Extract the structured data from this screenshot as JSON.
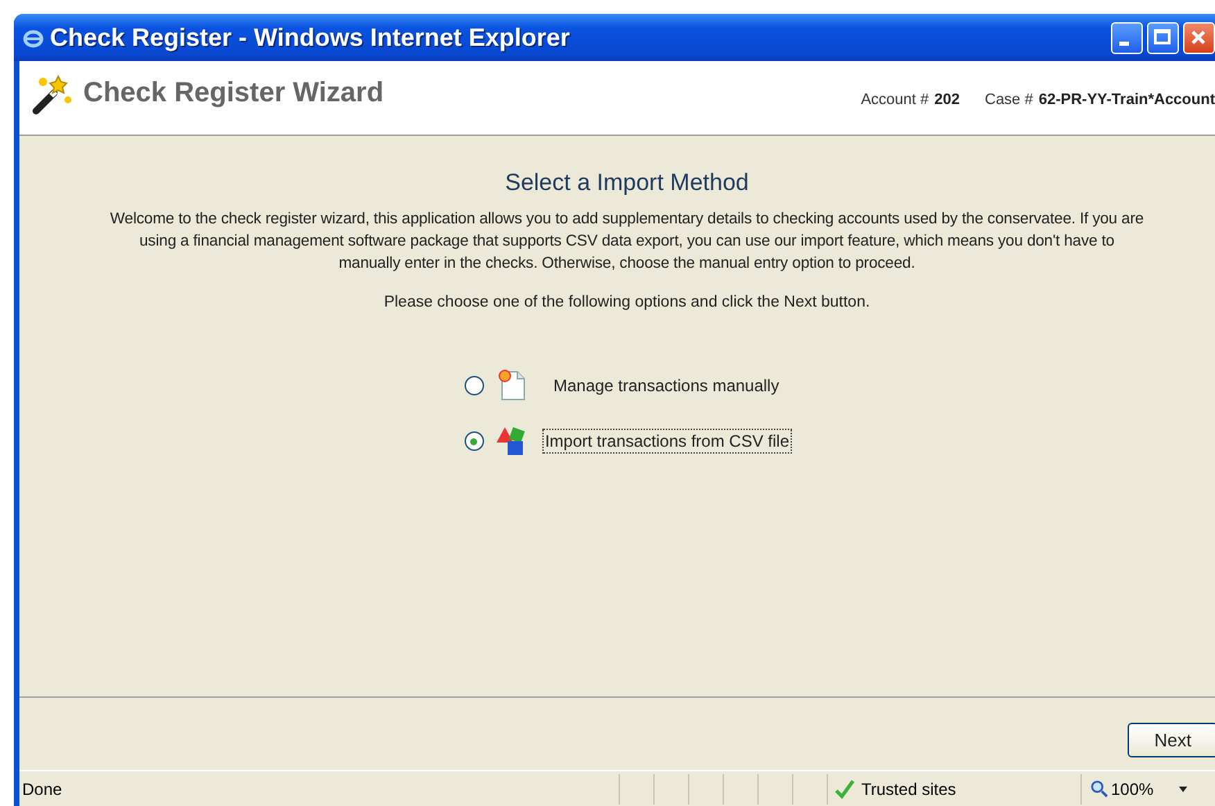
{
  "window": {
    "title": "Check Register - Windows Internet Explorer"
  },
  "header": {
    "title": "Check Register Wizard",
    "account_label": "Account #",
    "account": "202",
    "case_label": "Case #",
    "case": "62-PR-YY-Train*Account"
  },
  "content": {
    "heading": "Select a Import Method",
    "intro": "Welcome to the check register wizard, this application allows you to add supplementary details to checking accounts used by the conservatee. If you are using a financial management software package that supports CSV data export, you can use our import feature, which means you don't have to manually enter in the checks. Otherwise, choose the manual entry option to proceed.",
    "instruction": "Please choose one of the following options and click the Next button.",
    "options": [
      {
        "kind": "manual",
        "label": "Manage transactions manually",
        "selected": false
      },
      {
        "kind": "import",
        "label": "Import transactions from CSV file",
        "selected": true
      }
    ]
  },
  "buttons": [
    "Next"
  ],
  "status_bar": {
    "text": "Done",
    "zone": "Trusted sites",
    "zoom": "100%"
  }
}
